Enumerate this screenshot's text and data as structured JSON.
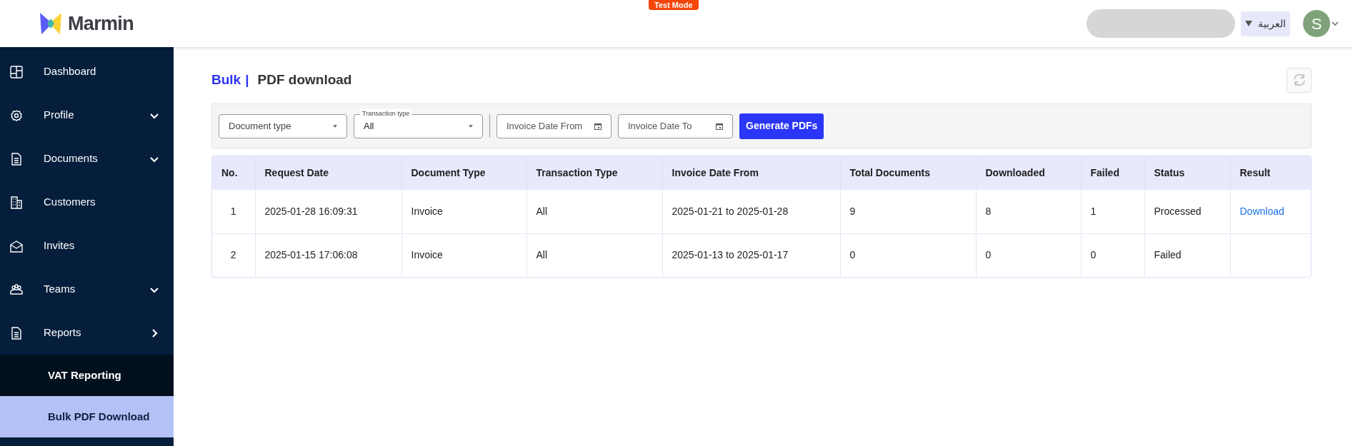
{
  "header": {
    "logo_text": "Marmin",
    "test_badge": "Test Mode",
    "language": "العربية",
    "avatar_initial": "S"
  },
  "sidebar": {
    "items": [
      {
        "label": "Dashboard",
        "kind": "link",
        "selected": false
      },
      {
        "label": "Profile",
        "kind": "dropdown",
        "selected": false
      },
      {
        "label": "Documents",
        "kind": "dropdown",
        "selected": false
      },
      {
        "label": "Customers",
        "kind": "link",
        "selected": false
      },
      {
        "label": "Invites",
        "kind": "link",
        "selected": false
      },
      {
        "label": "Teams",
        "kind": "dropdown",
        "selected": false
      },
      {
        "label": "Reports",
        "kind": "submenu",
        "selected": false
      },
      {
        "label": "VAT Reporting",
        "kind": "subitem",
        "selected": false
      },
      {
        "label": "Bulk PDF Download",
        "kind": "subitem",
        "selected": true
      }
    ]
  },
  "breadcrumb": {
    "parent": "Bulk",
    "separator": "|",
    "current": "PDF download"
  },
  "filters": {
    "document_type": {
      "placeholder": "Document type"
    },
    "transaction_type": {
      "label": "Transaction type",
      "value": "All"
    },
    "date_from": {
      "placeholder": "Invoice Date From"
    },
    "date_to": {
      "placeholder": "Invoice Date To"
    },
    "button": "Generate PDFs"
  },
  "table": {
    "columns": [
      "No.",
      "Request Date",
      "Document Type",
      "Transaction Type",
      "Invoice Date From",
      "Total Documents",
      "Downloaded",
      "Failed",
      "Status",
      "Result"
    ],
    "rows": [
      [
        "1",
        "2025-01-28 16:09:31",
        "Invoice",
        "All",
        "2025-01-21 to 2025-01-28",
        "9",
        "8",
        "1",
        "Processed",
        "Download"
      ],
      [
        "2",
        "2025-01-15 17:06:08",
        "Invoice",
        "All",
        "2025-01-13 to 2025-01-17",
        "0",
        "0",
        "0",
        "Failed"
      ]
    ]
  }
}
